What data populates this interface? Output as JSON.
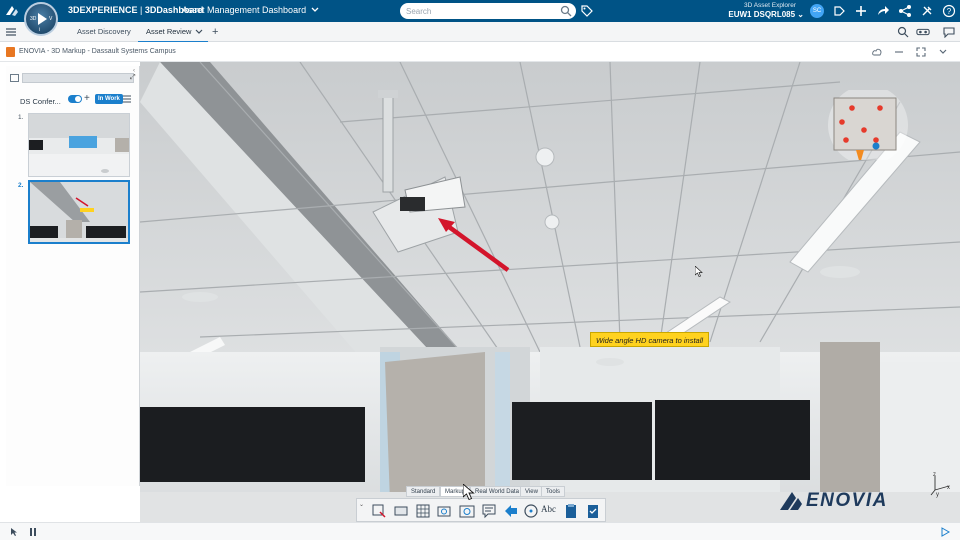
{
  "topbar": {
    "brand_prefix": "3DEXPERIENCE",
    "brand_separator": " | ",
    "brand_app": "3DDashboard",
    "dashboard_title": "Asset Management Dashboard",
    "search_placeholder": "Search",
    "user_app": "3D Asset Explorer",
    "tenant": "EUW1 DSQRL085",
    "avatar_initials": "SC",
    "compass": {
      "left": "3D",
      "right": "V",
      "bottom": "i"
    },
    "color": "#005386"
  },
  "tabs": {
    "items": [
      {
        "label": "Asset Discovery",
        "active": false
      },
      {
        "label": "Asset Review",
        "active": true
      }
    ],
    "add_label": "+"
  },
  "widget": {
    "title": "ENOVIA - 3D Markup - Dassault Systems Campus"
  },
  "left_panel": {
    "name": "DS Confer...",
    "status_badge": "In Work",
    "add_label": "+",
    "items": [
      {
        "number": "1.",
        "active": false
      },
      {
        "number": "2.",
        "active": true
      }
    ]
  },
  "viewer": {
    "annotation": "Wide angle HD camera to install",
    "annotation_color": "#ffd21f",
    "arrow_color": "#d3152b",
    "watermark": "ENOVIA",
    "axis_labels": {
      "x": "x",
      "y": "y",
      "z": "z"
    }
  },
  "toolbar": {
    "tabs": [
      {
        "label": "Standard",
        "active": false
      },
      {
        "label": "Markup",
        "active": true
      },
      {
        "label": "Real World Data",
        "active": false
      },
      {
        "label": "View",
        "active": false
      },
      {
        "label": "Tools",
        "active": false
      }
    ],
    "text_tool_label": "Abc",
    "collapse_label": "⌄"
  },
  "accent_color": "#1b7fcc"
}
